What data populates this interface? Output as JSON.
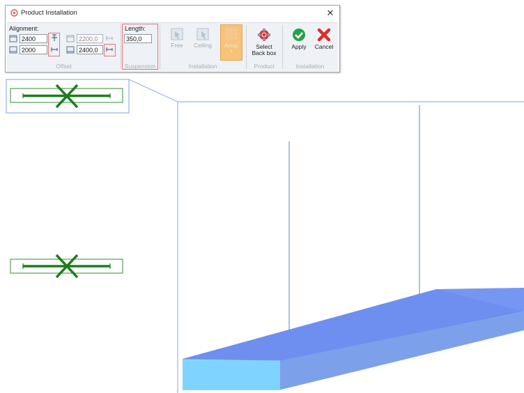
{
  "dialog": {
    "title": "Product Installation",
    "close_glyph": "✕",
    "offset": {
      "alignment_label": "Alignment:",
      "top_value": "2400",
      "bottom_value": "2000",
      "top_calc_value": "2200,0",
      "bottom_calc_value": "2400,0",
      "group_label": "Offset"
    },
    "suspension": {
      "length_label": "Length:",
      "length_value": "350,0",
      "group_label": "Suspension"
    },
    "installation": {
      "free_label": "Free",
      "ceiling_label": "Ceiling",
      "array_label": "Array",
      "array_arrow": "▾",
      "group_label": "Installation"
    },
    "product": {
      "select_line1": "Select",
      "select_line2": "Back box",
      "group_label": "Product"
    },
    "actions": {
      "apply_label": "Apply",
      "cancel_label": "Cancel",
      "group_label": "Installation"
    }
  },
  "colors": {
    "fixture_green": "#1e7d1e",
    "highlight_red": "#e8747b",
    "view_line_blue": "#9bb3ee",
    "box_top": "#6e8ff0",
    "box_front": "#7fd4ff",
    "array_active": "#f7c27a"
  },
  "icons": [
    "app-icon",
    "close-icon",
    "floor-align-icon",
    "pin-icon",
    "free-install-icon",
    "ceiling-install-icon",
    "array-icon",
    "back-box-icon",
    "apply-check-icon",
    "cancel-x-icon"
  ]
}
